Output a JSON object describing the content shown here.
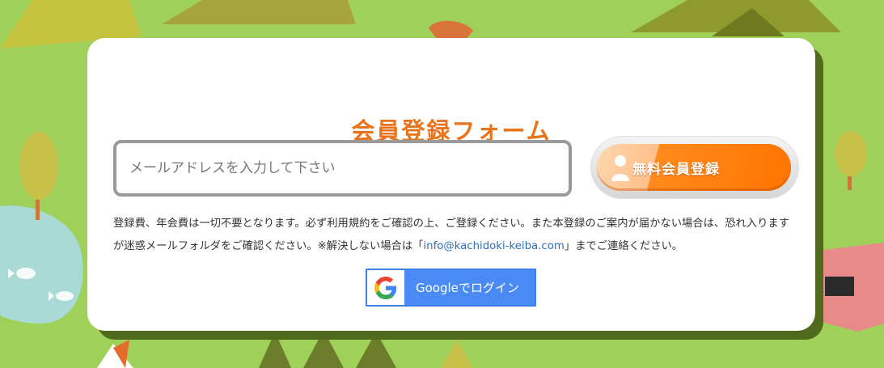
{
  "form": {
    "title": "会員登録フォーム",
    "email_placeholder": "メールアドレスを入力して下さい",
    "register_button": "無料会員登録",
    "notice_part1": "登録費、年会費は一切不要となります。必ず利用規約をご確認の上、ご登録ください。また本登録のご案内が届かない場合は、恐れ入りますが迷惑メールフォルダをご確認ください。※解決しない場合は「",
    "contact_email": "info@kachidoki-keiba.com",
    "notice_part2": "」までご連絡ください。",
    "google_login": "Googleでログイン"
  },
  "colors": {
    "background": "#9fd15a",
    "title": "#e8731a",
    "register_button": "#ff7400",
    "google_button": "#4a8af4",
    "link": "#2d6fb5"
  },
  "icons": {
    "register": "person-icon",
    "google": "google-logo-icon"
  }
}
